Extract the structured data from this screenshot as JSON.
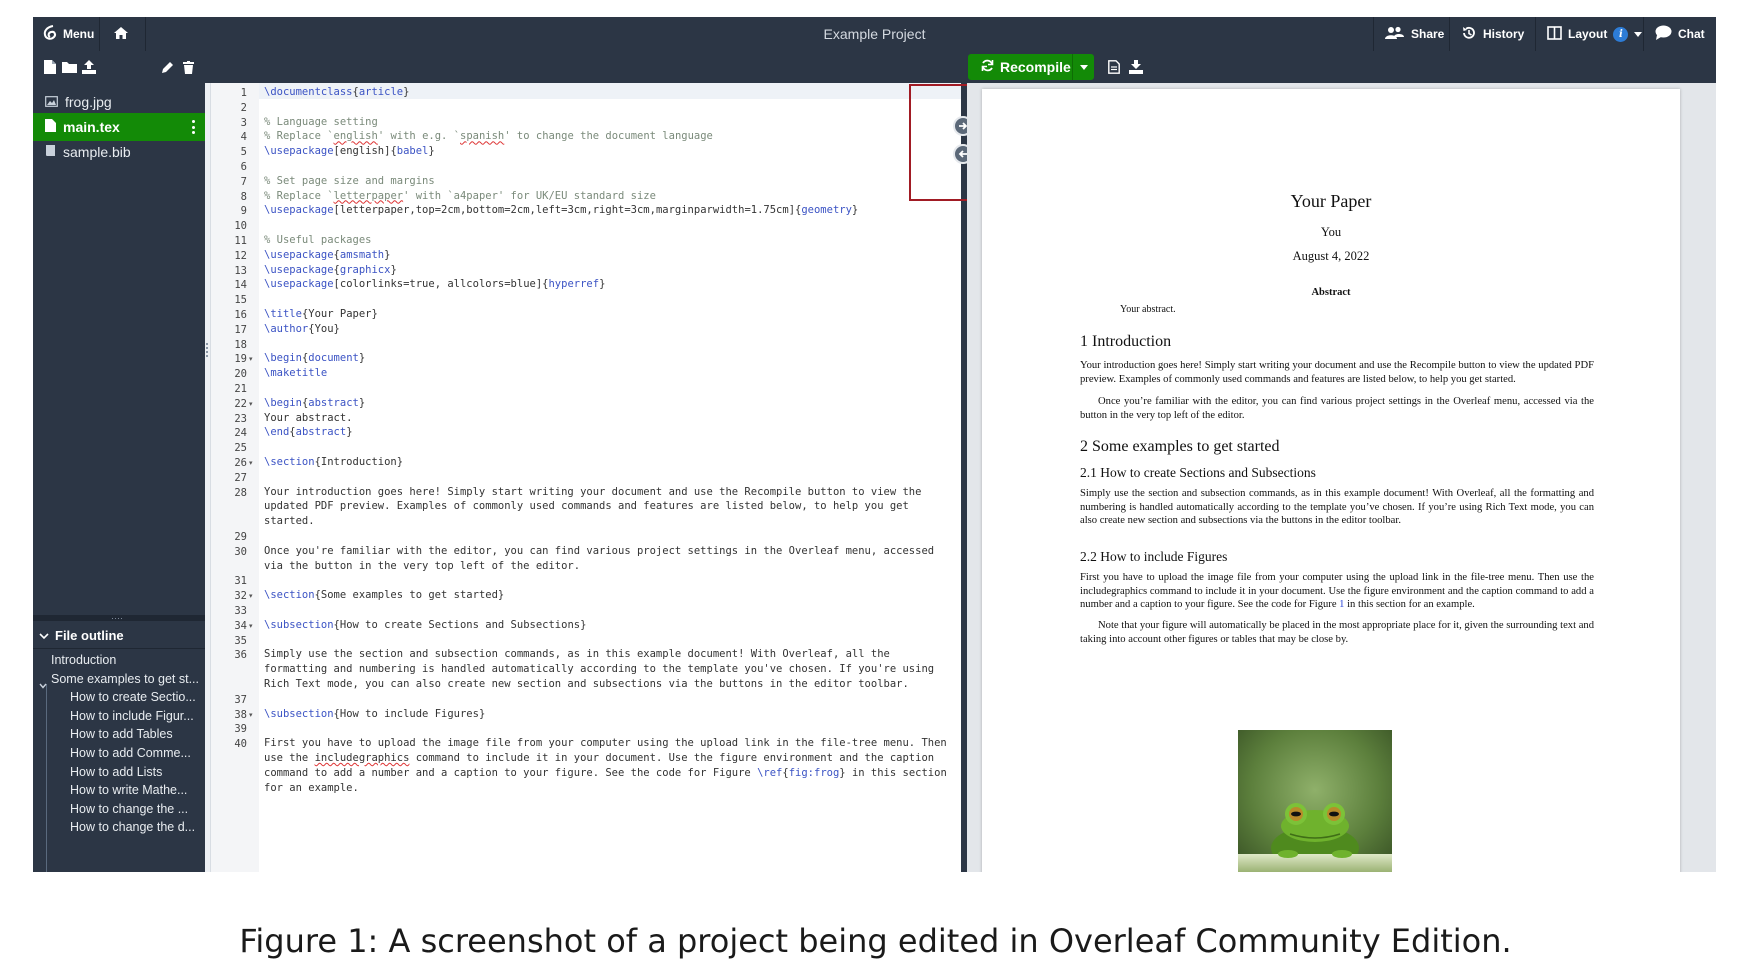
{
  "window": {
    "title": "Example Project"
  },
  "topbar": {
    "menu_label": "Menu",
    "share_label": "Share",
    "history_label": "History",
    "layout_label": "Layout",
    "layout_badge": "i",
    "chat_label": "Chat"
  },
  "toolbar": {
    "recompile_label": "Recompile"
  },
  "files": [
    {
      "name": "frog.jpg",
      "icon": "image-file-icon",
      "active": false
    },
    {
      "name": "main.tex",
      "icon": "file-icon",
      "active": true
    },
    {
      "name": "sample.bib",
      "icon": "book-file-icon",
      "active": false
    }
  ],
  "outline": {
    "header": "File outline",
    "items": [
      {
        "label": "Introduction",
        "level": 1
      },
      {
        "label": "Some examples to get st...",
        "level": 1,
        "expanded": true
      },
      {
        "label": "How to create Sectio...",
        "level": 2
      },
      {
        "label": "How to include Figur...",
        "level": 2
      },
      {
        "label": "How to add Tables",
        "level": 2
      },
      {
        "label": "How to add Comme...",
        "level": 2
      },
      {
        "label": "How to add Lists",
        "level": 2
      },
      {
        "label": "How to write Mathe...",
        "level": 2
      },
      {
        "label": "How to change the ...",
        "level": 2
      },
      {
        "label": "How to change the d...",
        "level": 2
      }
    ]
  },
  "editor": {
    "lines": [
      {
        "n": "1",
        "html": "<span class=\"c-cmd\">\\documentclass</span>{<span class=\"c-arg\">article</span>}"
      },
      {
        "n": "2",
        "html": ""
      },
      {
        "n": "3",
        "html": "<span class=\"c-com\">% Language setting</span>"
      },
      {
        "n": "4",
        "html": "<span class=\"c-com\">% Replace `<span class=\"squig\">english</span>' with e.g. `<span class=\"squig\">spanish</span>' to change the document language</span>"
      },
      {
        "n": "5",
        "html": "<span class=\"c-cmd\">\\usepackage</span>[english]{<span class=\"c-arg\">babel</span>}"
      },
      {
        "n": "6",
        "html": ""
      },
      {
        "n": "7",
        "html": "<span class=\"c-com\">% Set page size and margins</span>"
      },
      {
        "n": "8",
        "html": "<span class=\"c-com\">% Replace `<span class=\"squig\">letterpaper</span>' with `a4paper' for UK/EU standard size</span>"
      },
      {
        "n": "9",
        "html": "<span class=\"c-cmd\">\\usepackage</span>[letterpaper,top=2cm,bottom=2cm,left=3cm,right=3cm,marginparwidth=1.75cm]{<span class=\"c-arg\">geometry</span>}"
      },
      {
        "n": "10",
        "html": ""
      },
      {
        "n": "11",
        "html": "<span class=\"c-com\">% Useful packages</span>"
      },
      {
        "n": "12",
        "html": "<span class=\"c-cmd\">\\usepackage</span>{<span class=\"c-arg\">amsmath</span>}"
      },
      {
        "n": "13",
        "html": "<span class=\"c-cmd\">\\usepackage</span>{<span class=\"c-arg\">graphicx</span>}"
      },
      {
        "n": "14",
        "html": "<span class=\"c-cmd\">\\usepackage</span>[colorlinks=true, allcolors=blue]{<span class=\"c-arg\">hyperref</span>}"
      },
      {
        "n": "15",
        "html": ""
      },
      {
        "n": "16",
        "html": "<span class=\"c-cmd\">\\title</span>{Your Paper}"
      },
      {
        "n": "17",
        "html": "<span class=\"c-cmd\">\\author</span>{You}"
      },
      {
        "n": "18",
        "html": ""
      },
      {
        "n": "19",
        "fold": true,
        "html": "<span class=\"c-cmd\">\\begin</span>{<span class=\"c-arg\">document</span>}"
      },
      {
        "n": "20",
        "html": "<span class=\"c-cmd\">\\maketitle</span>"
      },
      {
        "n": "21",
        "html": ""
      },
      {
        "n": "22",
        "fold": true,
        "html": "<span class=\"c-cmd\">\\begin</span>{<span class=\"c-arg\">abstract</span>}"
      },
      {
        "n": "23",
        "html": "Your abstract."
      },
      {
        "n": "24",
        "html": "<span class=\"c-cmd\">\\end</span>{<span class=\"c-arg\">abstract</span>}"
      },
      {
        "n": "25",
        "html": ""
      },
      {
        "n": "26",
        "fold": true,
        "html": "<span class=\"c-cmd\">\\section</span>{Introduction}"
      },
      {
        "n": "27",
        "html": ""
      },
      {
        "n": "28",
        "rows": 3,
        "html": "Your introduction goes here! Simply start writing your document and use the Recompile button to view the updated PDF preview. Examples of commonly used commands and features are listed below, to help you get started."
      },
      {
        "n": "29",
        "html": ""
      },
      {
        "n": "30",
        "rows": 2,
        "html": "Once you're familiar with the editor, you can find various project settings in the Overleaf menu, accessed via the button in the very top left of the editor."
      },
      {
        "n": "31",
        "html": ""
      },
      {
        "n": "32",
        "fold": true,
        "html": "<span class=\"c-cmd\">\\section</span>{Some examples to get started}"
      },
      {
        "n": "33",
        "html": ""
      },
      {
        "n": "34",
        "fold": true,
        "html": "<span class=\"c-cmd\">\\subsection</span>{How to create Sections and Subsections}"
      },
      {
        "n": "35",
        "html": ""
      },
      {
        "n": "36",
        "rows": 3,
        "html": "Simply use the section and subsection commands, as in this example document! With Overleaf, all the formatting and numbering is handled automatically according to the template you've chosen. If you're using Rich Text mode, you can also create new section and subsections via the buttons in the editor toolbar."
      },
      {
        "n": "37",
        "html": ""
      },
      {
        "n": "38",
        "fold": true,
        "html": "<span class=\"c-cmd\">\\subsection</span>{How to include Figures}"
      },
      {
        "n": "39",
        "html": ""
      },
      {
        "n": "40",
        "rows": 4,
        "html": "First you have to upload the image file from your computer using the upload link in the file-tree menu. Then use the <span class=\"squig\">includegraphics</span> command to include it in your document. Use the figure environment and the caption command to add a number and a caption to your figure. See the code for Figure <span class=\"c-cmd\">\\ref</span>{<span class=\"c-arg\">fig:frog</span>} in this section for an example."
      }
    ]
  },
  "pdf": {
    "title": "Your Paper",
    "author": "You",
    "date": "August 4, 2022",
    "abstract_heading": "Abstract",
    "abstract_text": "Your abstract.",
    "sec1": "1 Introduction",
    "sec1_p1": "Your introduction goes here! Simply start writing your document and use the Recompile button to view the updated PDF preview. Examples of commonly used commands and features are listed below, to help you get started.",
    "sec1_p2": "Once you’re familiar with the editor, you can find various project settings in the Overleaf menu, accessed via the button in the very top left of the editor.",
    "sec2": "2 Some examples to get started",
    "sub21": "2.1 How to create Sections and Subsections",
    "sub21_p": "Simply use the section and subsection commands, as in this example document! With Overleaf, all the formatting and numbering is handled automatically according to the template you’ve chosen. If you’re using Rich Text mode, you can also create new section and subsections via the buttons in the editor toolbar.",
    "sub22": "2.2 How to include Figures",
    "sub22_p1_a": "First you have to upload the image file from your computer using the upload link in the file-tree menu. Then use the includegraphics command to include it in your document. Use the figure environment and the caption command to add a number and a caption to your figure. See the code for Figure ",
    "sub22_p1_link": "1",
    "sub22_p1_b": " in this section for an example.",
    "sub22_p2": "Note that your figure will automatically be placed in the most appropriate place for it, given the surrounding text and taking into account other figures or tables that may be close by."
  },
  "caption": "Figure 1: A screenshot of a project being edited in Overleaf Community Edition.",
  "colors": {
    "accent_green": "#138a07",
    "chrome_dark": "#2c3645",
    "highlight_red": "#a11b24"
  }
}
